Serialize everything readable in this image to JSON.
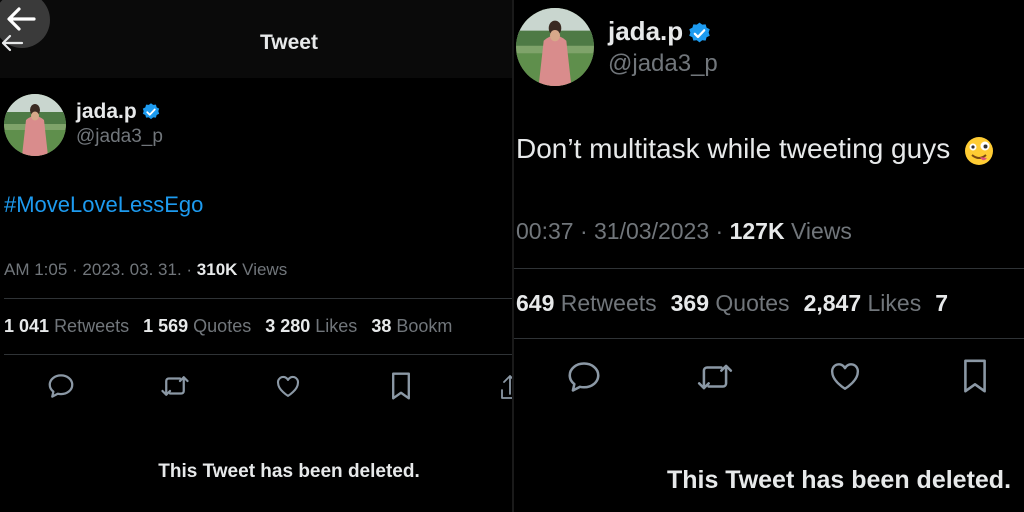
{
  "left": {
    "header": {
      "title": "Tweet"
    },
    "author": {
      "name": "jada.p",
      "handle": "@jada3_p"
    },
    "tweet": {
      "text": "#MoveLoveLessEgo"
    },
    "meta": {
      "time": "AM 1:05",
      "date": "2023. 03. 31.",
      "views_count": "310K",
      "views_label": "Views"
    },
    "stats": {
      "retweets_count": "1 041",
      "retweets_label": "Retweets",
      "quotes_count": "1 569",
      "quotes_label": "Quotes",
      "likes_count": "3 280",
      "likes_label": "Likes",
      "bookmarks_count": "38",
      "bookmarks_label": "Bookm"
    },
    "deleted_notice": "This Tweet has been deleted."
  },
  "right": {
    "author": {
      "name": "jada.p",
      "handle": "@jada3_p"
    },
    "tweet": {
      "text": "Don’t multitask while tweeting guys"
    },
    "meta": {
      "time": "00:37",
      "date": "31/03/2023",
      "views_count": "127K",
      "views_label": "Views"
    },
    "stats": {
      "retweets_count": "649",
      "retweets_label": "Retweets",
      "quotes_count": "369",
      "quotes_label": "Quotes",
      "likes_count": "2,847",
      "likes_label": "Likes",
      "bookmarks_count": "7"
    },
    "deleted_notice": "This Tweet has been deleted."
  },
  "icons": [
    "back-arrow-icon",
    "verified-badge-icon",
    "reply-icon",
    "retweet-icon",
    "like-icon",
    "bookmark-icon",
    "share-icon",
    "emoji-icon"
  ],
  "colors": {
    "background": "#000000",
    "text": "#e7e9ea",
    "muted": "#71767b",
    "link": "#1d9bf0",
    "verified": "#1d9bf0",
    "divider": "#2f3336"
  }
}
